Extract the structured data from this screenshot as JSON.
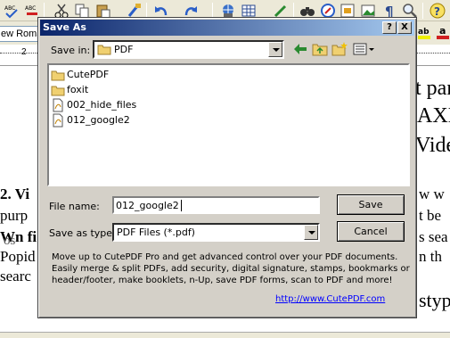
{
  "background_app": {
    "font_box": "ew Roman",
    "ruler_mark": "2",
    "doc_lines_left": [
      "2. Vi",
      "purp",
      "Wn fi",
      "Popid",
      "searc"
    ],
    "doc_lines_right": [
      "t par",
      "AXI",
      "Vide",
      "w w",
      "t be",
      "s sea",
      "n th",
      "styp"
    ],
    "doc_overlap_left": "os"
  },
  "dialog": {
    "title": "Save As",
    "help_button": "?",
    "close_button": "X",
    "save_in_label": "Save in:",
    "save_in_value": "PDF",
    "files": [
      {
        "name": "CutePDF",
        "type": "folder"
      },
      {
        "name": "foxit",
        "type": "folder"
      },
      {
        "name": "002_hide_files",
        "type": "pdf"
      },
      {
        "name": "012_google2",
        "type": "pdf"
      }
    ],
    "file_name_label": "File name:",
    "file_name_value": "012_google2",
    "save_as_type_label": "Save as type:",
    "save_as_type_value": "PDF Files (*.pdf)",
    "save_button": "Save",
    "cancel_button": "Cancel",
    "promo_lines": [
      "Move up to CutePDF Pro and get advanced control over your PDF documents.",
      "Easily merge & split PDFs, add security, digital signature, stamps, bookmarks or",
      "header/footer, make booklets, n-Up, save PDF forms, scan to PDF and more!"
    ],
    "promo_link": "http://www.CutePDF.com"
  },
  "colors": {
    "title_start": "#0a246a",
    "title_end": "#a6caf0",
    "dialog_face": "#d4d0c8",
    "link": "#0000ff"
  }
}
